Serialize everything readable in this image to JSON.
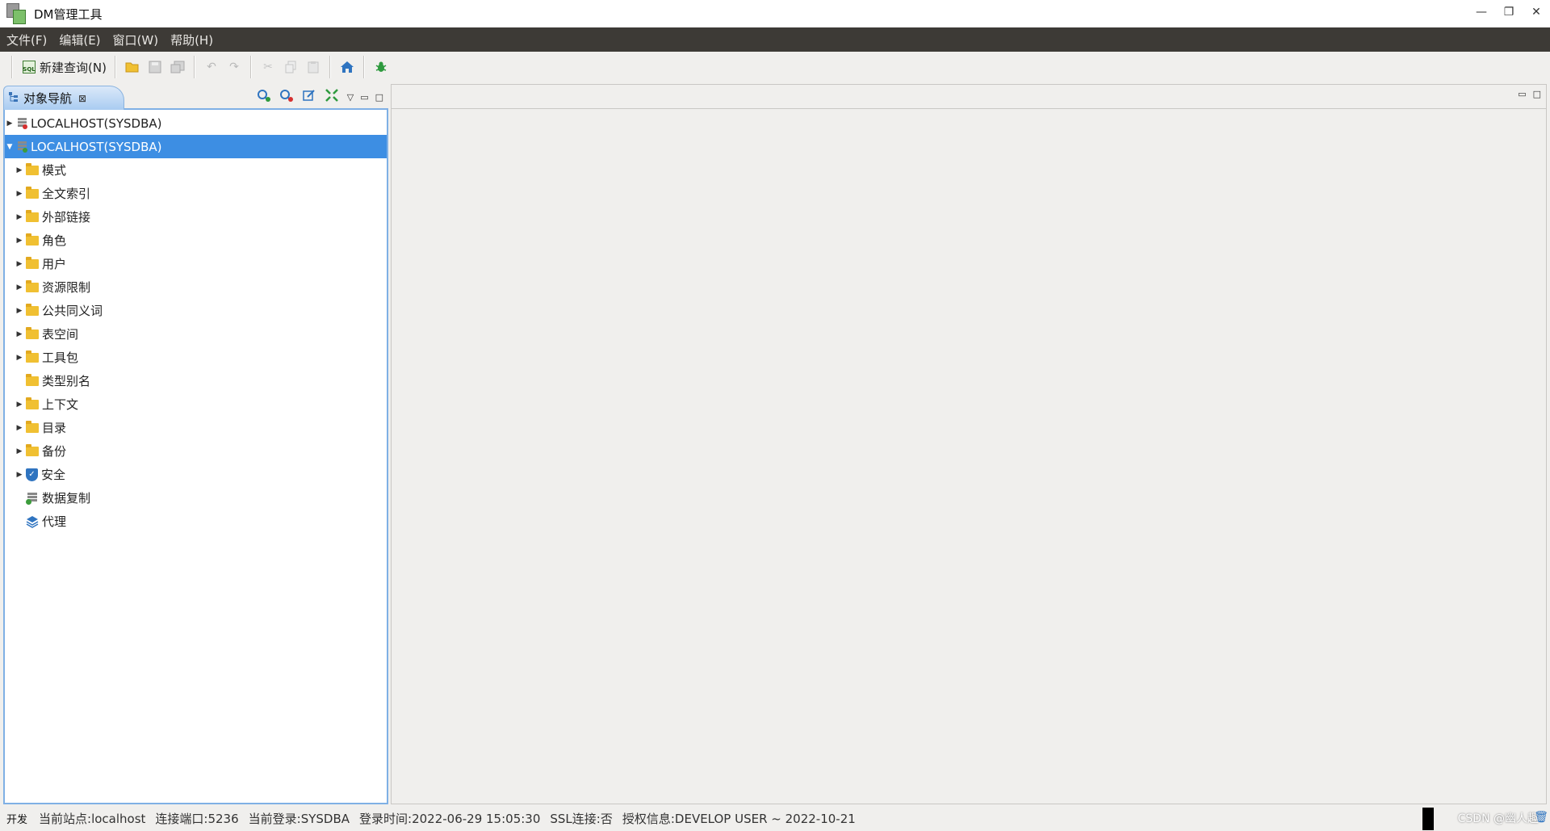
{
  "window": {
    "title": "DM管理工具",
    "controls": {
      "minimize": "—",
      "restore": "❐",
      "close": "✕"
    }
  },
  "menu": [
    "文件(F)",
    "编辑(E)",
    "窗口(W)",
    "帮助(H)"
  ],
  "toolbar": {
    "new_query_label": "新建查询(N)",
    "new_query_icon_text": "SQL",
    "icons": [
      "sql-icon",
      "folder-open-icon",
      "save-icon",
      "save-all-icon",
      "undo-icon",
      "redo-icon",
      "cut-icon",
      "copy-icon",
      "paste-icon",
      "home-icon",
      "bug-icon"
    ]
  },
  "nav": {
    "tab_label": "对象导航",
    "tab_close": "⊠",
    "tree": [
      {
        "label": "LOCALHOST(SYSDBA)",
        "type": "db",
        "expanded": false,
        "selected": false,
        "level": 0
      },
      {
        "label": "LOCALHOST(SYSDBA)",
        "type": "db",
        "expanded": true,
        "selected": true,
        "level": 0
      },
      {
        "label": "模式",
        "type": "folder",
        "level": 1,
        "has_children": true
      },
      {
        "label": "全文索引",
        "type": "folder",
        "level": 1,
        "has_children": true
      },
      {
        "label": "外部链接",
        "type": "folder",
        "level": 1,
        "has_children": true
      },
      {
        "label": "角色",
        "type": "folder",
        "level": 1,
        "has_children": true
      },
      {
        "label": "用户",
        "type": "folder",
        "level": 1,
        "has_children": true
      },
      {
        "label": "资源限制",
        "type": "folder",
        "level": 1,
        "has_children": true
      },
      {
        "label": "公共同义词",
        "type": "folder",
        "level": 1,
        "has_children": true
      },
      {
        "label": "表空间",
        "type": "folder",
        "level": 1,
        "has_children": true
      },
      {
        "label": "工具包",
        "type": "folder",
        "level": 1,
        "has_children": true
      },
      {
        "label": "类型别名",
        "type": "folder",
        "level": 1,
        "has_children": false
      },
      {
        "label": "上下文",
        "type": "folder",
        "level": 1,
        "has_children": true
      },
      {
        "label": "目录",
        "type": "folder",
        "level": 1,
        "has_children": true
      },
      {
        "label": "备份",
        "type": "folder",
        "level": 1,
        "has_children": true
      },
      {
        "label": "安全",
        "type": "shield",
        "level": 1,
        "has_children": true
      },
      {
        "label": "数据复制",
        "type": "replication",
        "level": 1,
        "has_children": false
      },
      {
        "label": "代理",
        "type": "layers",
        "level": 1,
        "has_children": false
      }
    ]
  },
  "status": {
    "mode": "开发",
    "items": [
      "当前站点:localhost",
      "连接端口:5236",
      "当前登录:SYSDBA",
      "登录时间:2022-06-29 15:05:30",
      "SSL连接:否",
      "授权信息:DEVELOP USER ~ 2022-10-21"
    ],
    "watermark": "CSDN @幽人趣"
  },
  "colors": {
    "menubar": "#3d3a36",
    "selection": "#3d8ee3",
    "panel_border": "#7fb0e5",
    "folder": "#f0c032"
  }
}
